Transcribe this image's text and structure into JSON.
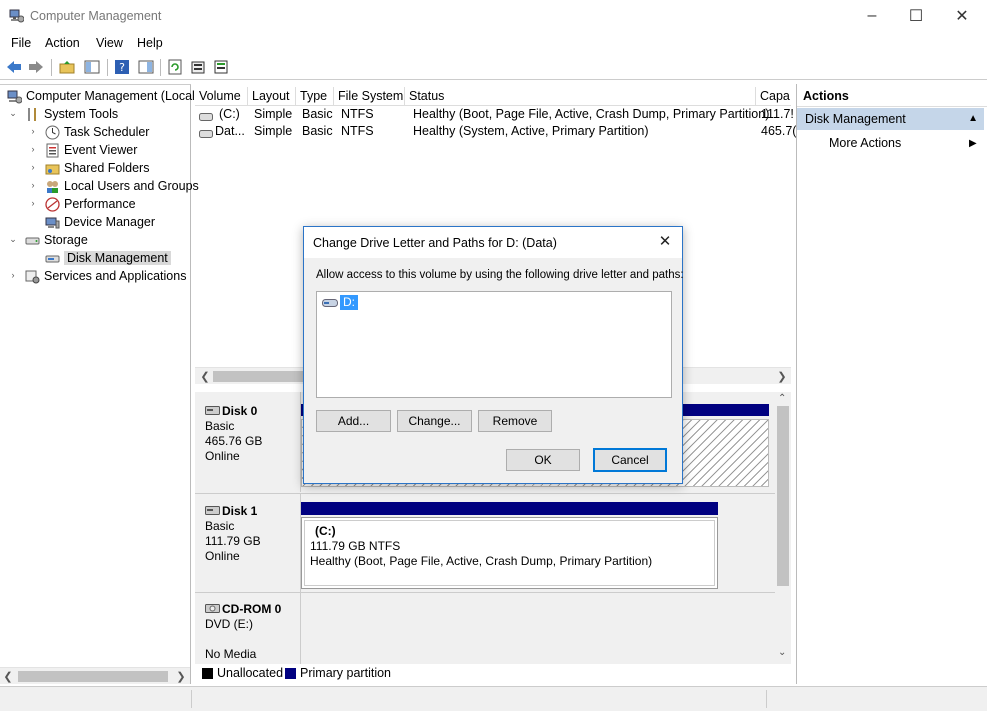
{
  "window": {
    "title": "Computer Management"
  },
  "menu": [
    "File",
    "Action",
    "View",
    "Help"
  ],
  "tree": {
    "root": "Computer Management (Local",
    "system_tools": "System Tools",
    "items": [
      "Task Scheduler",
      "Event Viewer",
      "Shared Folders",
      "Local Users and Groups",
      "Performance",
      "Device Manager"
    ],
    "storage": "Storage",
    "disk_management": "Disk Management",
    "services": "Services and Applications"
  },
  "volume_table": {
    "columns": [
      "Volume",
      "Layout",
      "Type",
      "File System",
      "Status",
      "Capa"
    ],
    "rows": [
      {
        "volume": "(C:)",
        "layout": "Simple",
        "type": "Basic",
        "fs": "NTFS",
        "status": "Healthy (Boot, Page File, Active, Crash Dump, Primary Partition)",
        "capacity": "111.7!"
      },
      {
        "volume": "Dat...",
        "layout": "Simple",
        "type": "Basic",
        "fs": "NTFS",
        "status": "Healthy (System, Active, Primary Partition)",
        "capacity": "465.7("
      }
    ]
  },
  "disks": [
    {
      "name": "Disk 0",
      "type": "Basic",
      "size": "465.76 GB",
      "state": "Online"
    },
    {
      "name": "Disk 1",
      "type": "Basic",
      "size": "111.79 GB",
      "state": "Online",
      "partition": {
        "label": "(C:)",
        "size": "111.79 GB NTFS",
        "status": "Healthy (Boot, Page File, Active, Crash Dump, Primary Partition)"
      }
    },
    {
      "name": "CD-ROM 0",
      "type": "DVD (E:)",
      "state": "No Media"
    }
  ],
  "legend": {
    "unallocated": "Unallocated",
    "primary": "Primary partition"
  },
  "actions": {
    "header": "Actions",
    "section": "Disk Management",
    "more": "More Actions"
  },
  "dialog": {
    "title": "Change Drive Letter and Paths for D: (Data)",
    "instruction": "Allow access to this volume by using the following drive letter and paths:",
    "drive": "D:",
    "add": "Add...",
    "change": "Change...",
    "remove": "Remove",
    "ok": "OK",
    "cancel": "Cancel"
  },
  "colors": {
    "primary_partition": "#000080",
    "selection_blue": "#3399ff",
    "action_section": "#c5d6e9"
  }
}
